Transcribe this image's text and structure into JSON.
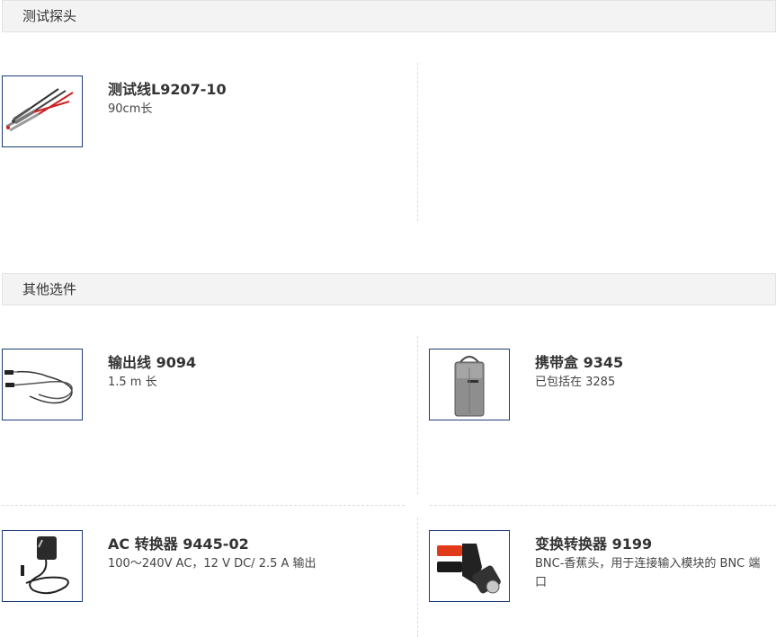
{
  "sections": [
    {
      "heading": "测试探头",
      "products": [
        {
          "name": "测试线L9207-10",
          "desc": "90cm长",
          "icon": "test-lead-image"
        }
      ]
    },
    {
      "heading": "其他选件",
      "products": [
        {
          "name": "输出线 9094",
          "desc": "1.5 m 长",
          "icon": "output-cable-image"
        },
        {
          "name": "携带盒 9345",
          "desc": "已包括在 3285",
          "icon": "carrying-case-image"
        },
        {
          "name": "AC 转换器 9445-02",
          "desc": "100～240V AC，12 V DC/ 2.5 A 输出",
          "icon": "ac-adapter-image"
        },
        {
          "name": "变换转换器 9199",
          "desc": "BNC-香蕉头，用于连接输入模块的 BNC 端口",
          "icon": "bnc-adapter-image"
        }
      ]
    }
  ],
  "colors": {
    "thumb_border": "#1d3c78",
    "header_bg": "#f3f3f3",
    "text": "#333333"
  }
}
